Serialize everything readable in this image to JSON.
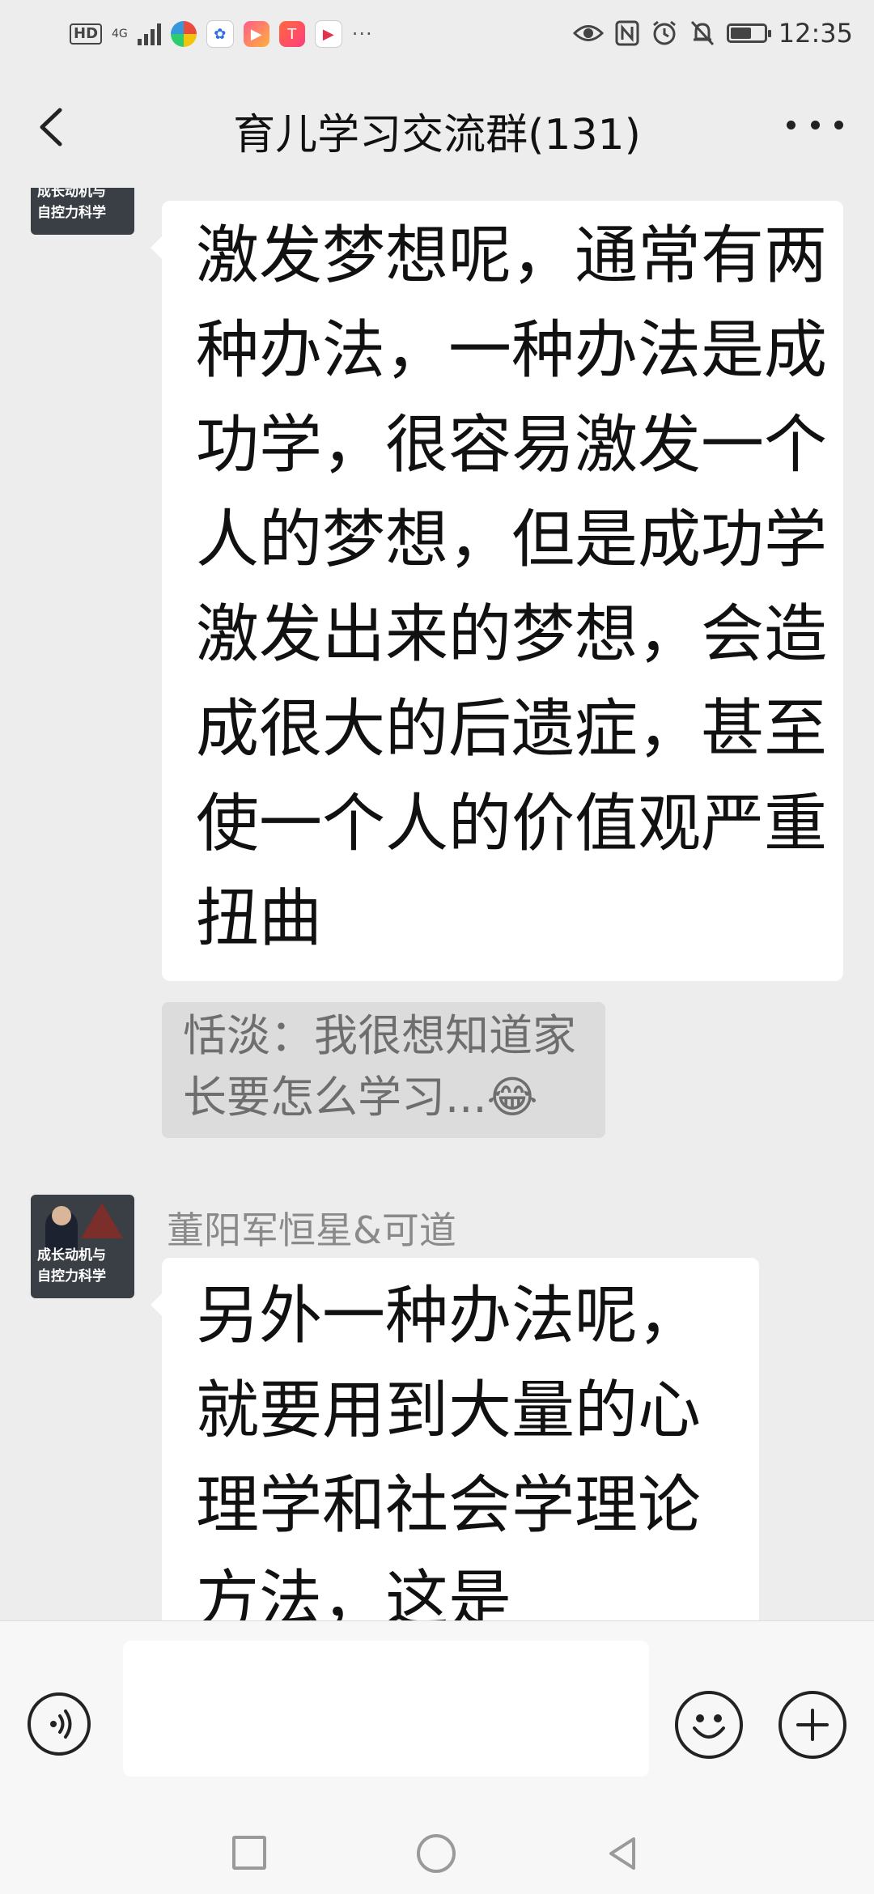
{
  "status_bar": {
    "hd_label": "HD",
    "network_label": "4G",
    "overflow_label": "···",
    "time": "12:35",
    "battery_level_percent": 70
  },
  "header": {
    "title": "育儿学习交流群(131)"
  },
  "messages": [
    {
      "avatar_text": "成长动机与\n自控力科学",
      "text": "激发梦想呢，通常有两种办法，一种办法是成功学，很容易激发一个人的梦想，但是成功学激发出来的梦想，会造成很大的后遗症，甚至使一个人的价值观严重扭曲"
    },
    {
      "sender": "董阳军恒星&可道",
      "avatar_text": "成长动机与\n自控力科学",
      "text": "另外一种办法呢，就要用到大量的心理学和社会学理论方法，这是"
    }
  ],
  "quote": {
    "text": "恬淡：我很想知道家长要怎么学习...😂"
  },
  "input_bar": {
    "placeholder": ""
  },
  "colors": {
    "background": "#ededed",
    "bubble": "#ffffff",
    "quote_bg": "#dcdcdc",
    "sender_text": "#8a8a8a"
  }
}
